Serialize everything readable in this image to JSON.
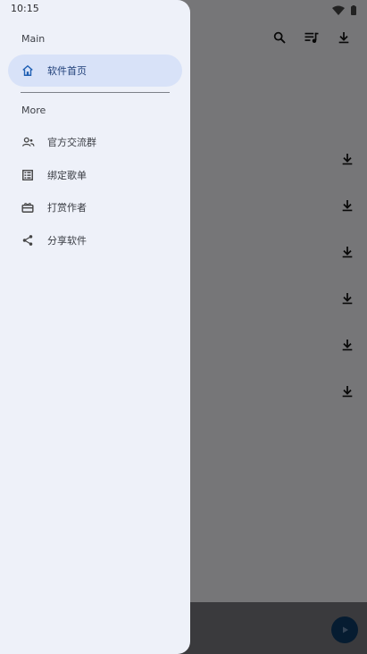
{
  "status_bar": {
    "time": "10:15",
    "icons": [
      "wifi-icon",
      "battery-icon"
    ]
  },
  "app": {
    "toolbar_icons": [
      "search-icon",
      "playlist-icon",
      "download-icon"
    ],
    "download_row_count_visible": 6,
    "fab_icon": "play-icon"
  },
  "drawer": {
    "main_section_title": "Main",
    "main_items": [
      {
        "label": "软件首页",
        "icon": "home-icon",
        "active": true
      }
    ],
    "more_section_title": "More",
    "more_items": [
      {
        "label": "官方交流群",
        "icon": "group-icon"
      },
      {
        "label": "绑定歌单",
        "icon": "list-icon"
      },
      {
        "label": "打赏作者",
        "icon": "gift-icon"
      },
      {
        "label": "分享软件",
        "icon": "share-icon"
      }
    ]
  },
  "colors": {
    "drawer_bg": "#eef1f9",
    "active_item_bg": "#d8e2f8",
    "active_accent": "#1f3f78",
    "fab": "#0e3b66"
  }
}
